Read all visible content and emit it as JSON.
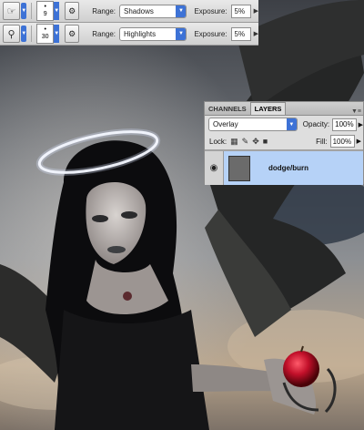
{
  "toolbar_shadows": {
    "brush_size": "9",
    "range_label": "Range:",
    "range_value": "Shadows",
    "exposure_label": "Exposure:",
    "exposure_value": "5%"
  },
  "toolbar_highlights": {
    "brush_size": "30",
    "range_label": "Range:",
    "range_value": "Highlights",
    "exposure_label": "Exposure:",
    "exposure_value": "5%"
  },
  "layers_panel": {
    "tabs": [
      "CHANNELS",
      "LAYERS"
    ],
    "active_tab": "LAYERS",
    "blend_mode": "Overlay",
    "opacity_label": "Opacity:",
    "opacity_value": "100%",
    "lock_label": "Lock:",
    "fill_label": "Fill:",
    "fill_value": "100%",
    "layers": [
      {
        "name": "dodge/burn",
        "visible": true,
        "selected": true
      }
    ]
  },
  "icons": {
    "dodge_tool": "hand-icon",
    "burn_tool": "magnifier-icon",
    "airbrush": "airbrush-icon",
    "visibility": "eye-icon"
  },
  "colors": {
    "selection_highlight": "#b6d2f7",
    "dropdown_accent": "#3d72d6"
  }
}
